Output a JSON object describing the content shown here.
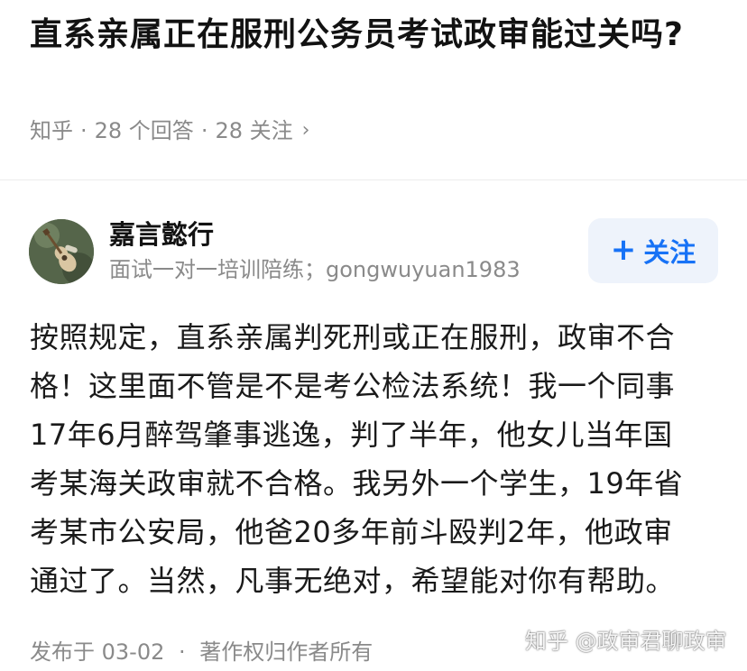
{
  "question": {
    "title": "直系亲属正在服刑公务员考试政审能过关吗?",
    "source": "知乎",
    "answers_count": "28 个回答",
    "followers_count": "28 关注",
    "separator": "·",
    "chevron_icon": "chevron-right-icon"
  },
  "author": {
    "name": "嘉言懿行",
    "bio": "面试一对一培训陪练；gongwuyuan1983",
    "avatar_icon": "guitar-on-grass-avatar",
    "follow_label": "关注",
    "follow_plus": "+"
  },
  "answer": {
    "lines": [
      "按照规定，直系亲属判死刑或正在服刑，政审不合",
      "格！这里面不管是不是考公检法系统！我一个同事",
      "17年6月醉驾肇事逃逸，判了半年，他女儿当年国",
      "考某海关政审就不合格。我另外一个学生，19年省",
      "考某市公安局，他爸20多年前斗殴判2年，他政审",
      "通过了。当然，凡事无绝对，希望能对你有帮助。"
    ]
  },
  "footer": {
    "published": "发布于 03-02",
    "separator": "·",
    "copyright": "著作权归作者所有"
  },
  "watermark": "知乎 @政审君聊政审",
  "colors": {
    "accent": "#1772f6",
    "follow_bg": "#eef3fb",
    "meta_text": "#8a8a8a",
    "title_text": "#121212"
  }
}
